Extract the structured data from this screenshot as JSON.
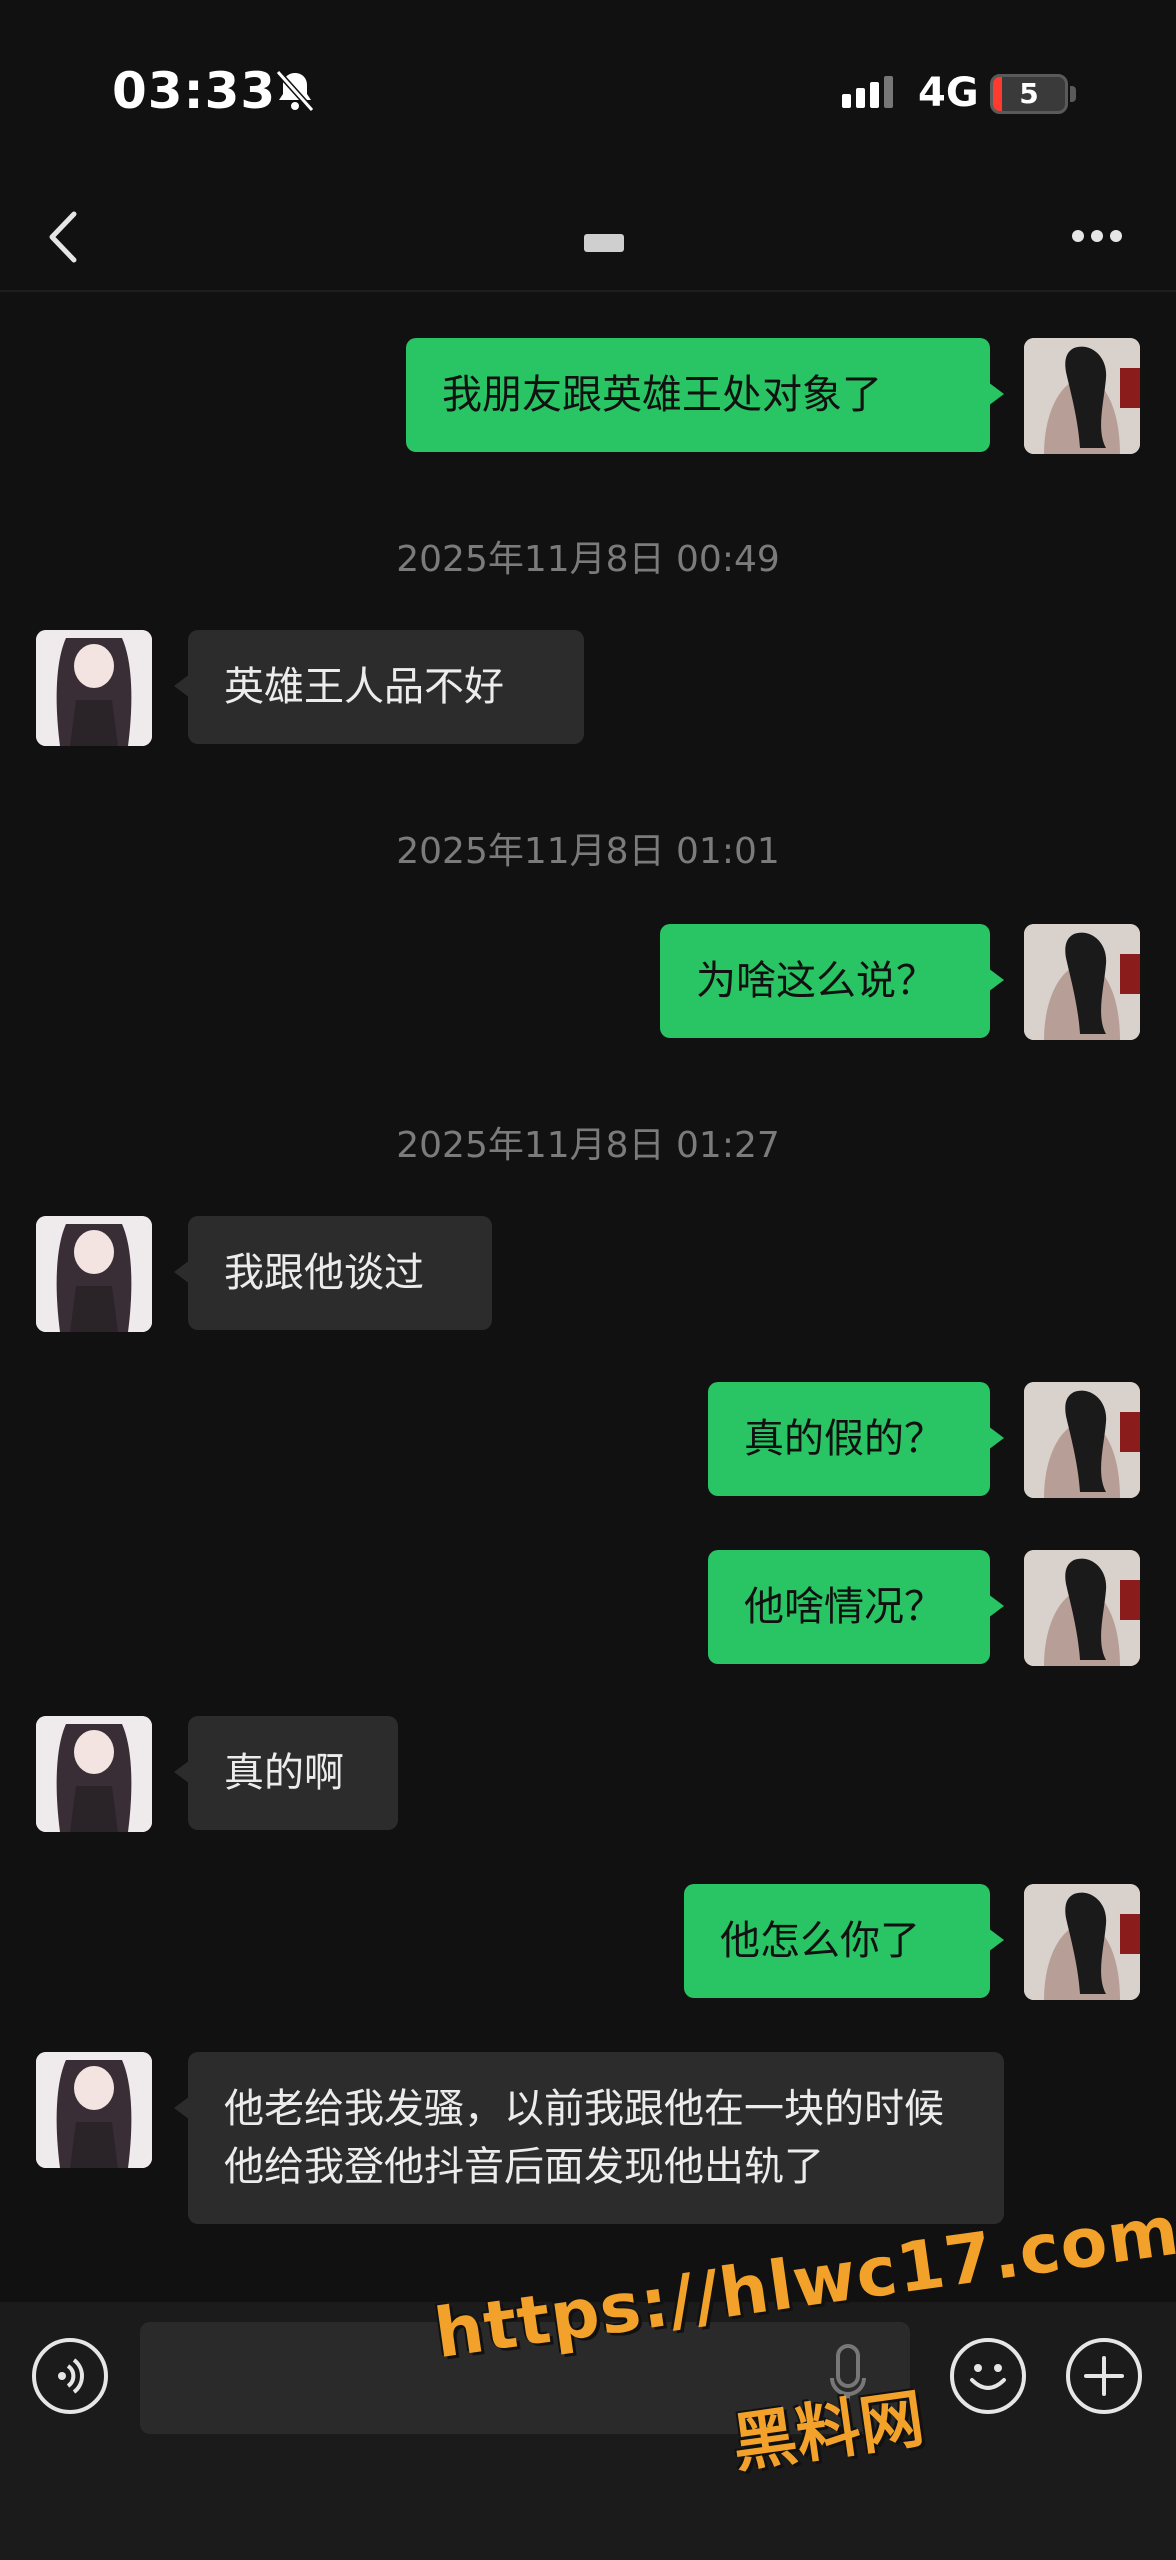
{
  "status_bar": {
    "time": "03:33",
    "network": "4G",
    "battery": "5",
    "battery_fraction": 0.05
  },
  "nav": {
    "title": "",
    "back_icon": "chevron-left-icon",
    "more_icon": "more-dots-icon"
  },
  "messages": [
    {
      "side": "me",
      "text": "我朋友跟英雄王处对象了"
    },
    {
      "type": "timestamp",
      "text": "2025年11月8日 00:49"
    },
    {
      "side": "them",
      "text": "英雄王人品不好"
    },
    {
      "type": "timestamp",
      "text": "2025年11月8日 01:01"
    },
    {
      "side": "me",
      "text": "为啥这么说？"
    },
    {
      "type": "timestamp",
      "text": "2025年11月8日 01:27"
    },
    {
      "side": "them",
      "text": "我跟他谈过"
    },
    {
      "side": "me",
      "text": "真的假的？"
    },
    {
      "side": "me",
      "text": "他啥情况？"
    },
    {
      "side": "them",
      "text": "真的啊"
    },
    {
      "side": "me",
      "text": "他怎么你了"
    },
    {
      "side": "them",
      "text": "他老给我发骚，以前我跟他在一块的时候他给我登他抖音后面发现他出轨了"
    }
  ],
  "watermark": {
    "url": "https://hlwc17.com",
    "name": "黑料网"
  },
  "colors": {
    "my_bubble": "#29c463",
    "their_bubble": "#2c2c2c",
    "background": "#111111",
    "watermark": "#f2a22a"
  }
}
